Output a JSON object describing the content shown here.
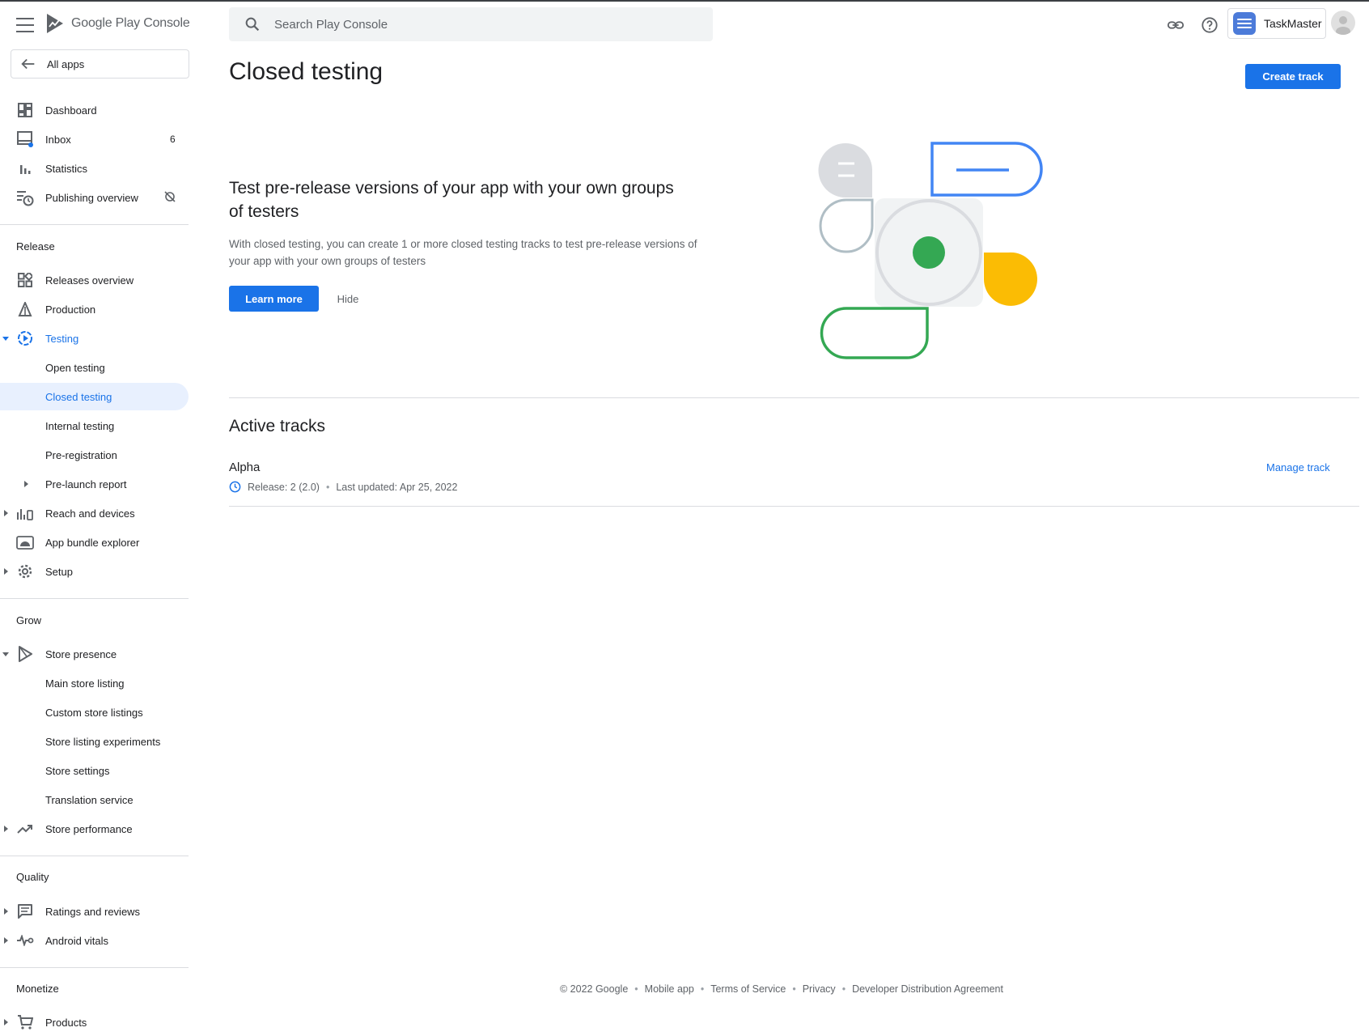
{
  "header": {
    "logo_text": "Google Play Console",
    "search_placeholder": "Search Play Console",
    "app_name": "TaskMaster"
  },
  "sidebar": {
    "all_apps": "All apps",
    "items": [
      {
        "label": "Dashboard"
      },
      {
        "label": "Inbox",
        "count": "6"
      },
      {
        "label": "Statistics"
      },
      {
        "label": "Publishing overview"
      }
    ],
    "release": {
      "heading": "Release",
      "items": [
        {
          "label": "Releases overview"
        },
        {
          "label": "Production"
        },
        {
          "label": "Testing"
        },
        {
          "label": "Open testing"
        },
        {
          "label": "Closed testing"
        },
        {
          "label": "Internal testing"
        },
        {
          "label": "Pre-registration"
        },
        {
          "label": "Pre-launch report"
        },
        {
          "label": "Reach and devices"
        },
        {
          "label": "App bundle explorer"
        },
        {
          "label": "Setup"
        }
      ]
    },
    "grow": {
      "heading": "Grow",
      "items": [
        {
          "label": "Store presence"
        },
        {
          "label": "Main store listing"
        },
        {
          "label": "Custom store listings"
        },
        {
          "label": "Store listing experiments"
        },
        {
          "label": "Store settings"
        },
        {
          "label": "Translation service"
        },
        {
          "label": "Store performance"
        }
      ]
    },
    "quality": {
      "heading": "Quality",
      "items": [
        {
          "label": "Ratings and reviews"
        },
        {
          "label": "Android vitals"
        }
      ]
    },
    "monetize": {
      "heading": "Monetize",
      "items": [
        {
          "label": "Products"
        }
      ]
    }
  },
  "main": {
    "title": "Closed testing",
    "create_track": "Create track",
    "intro": {
      "heading": "Test pre-release versions of your app with your own groups of testers",
      "body": "With closed testing, you can create 1 or more closed testing tracks to test pre-release versions of your app with your own groups of testers",
      "learn_more": "Learn more",
      "hide": "Hide"
    },
    "active_tracks": {
      "heading": "Active tracks",
      "tracks": [
        {
          "name": "Alpha",
          "release": "Release: 2 (2.0)",
          "updated": "Last updated: Apr 25, 2022",
          "action": "Manage track"
        }
      ]
    }
  },
  "footer": {
    "copyright": "© 2022 Google",
    "links": [
      "Mobile app",
      "Terms of Service",
      "Privacy",
      "Developer Distribution Agreement"
    ]
  },
  "colors": {
    "accent": "#1a73e8",
    "selected_bg": "#e8f0fe",
    "illustration_green": "#34a853",
    "illustration_yellow": "#fbbc04",
    "illustration_blue": "#4285f4"
  }
}
